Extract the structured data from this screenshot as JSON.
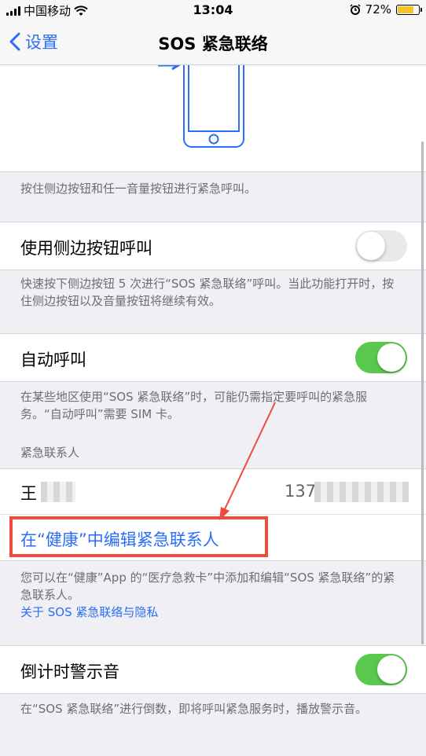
{
  "status": {
    "carrier": "中国移动",
    "time": "13:04",
    "battery": "72%",
    "battery_level": 0.72
  },
  "nav": {
    "back_label": "设置",
    "title": "SOS 紧急联络"
  },
  "illustration": {
    "icon": "phone-side-button-icon"
  },
  "hold_note": "按住侧边按钮和任一音量按钮进行紧急呼叫。",
  "side_button": {
    "label": "使用侧边按钮呼叫",
    "on": false
  },
  "side_note": "快速按下侧边按钮 5 次进行“SOS 紧急联络”呼叫。当此功能打开时，按住侧边按钮以及音量按钮将继续有效。",
  "auto_call": {
    "label": "自动呼叫",
    "on": true
  },
  "auto_note": "在某些地区使用“SOS 紧急联络”时，可能仍需指定要呼叫的紧急服务。“自动呼叫”需要 SIM 卡。",
  "contacts_header": "紧急联系人",
  "contact": {
    "name": "王",
    "phone": "137"
  },
  "edit_link": "在“健康”中编辑紧急联系人",
  "contacts_note": "您可以在“健康”App 的“医疗急救卡”中添加和编辑“SOS 紧急联络”的紧急联系人。",
  "privacy_link": "关于 SOS 紧急联络与隐私",
  "countdown": {
    "label": "倒计时警示音",
    "on": true
  },
  "countdown_note": "在“SOS 紧急联络”进行倒数，即将呼叫紧急服务时，播放警示音。",
  "colors": {
    "accent": "#2a6ef6",
    "toggle_on": "#5ac84d",
    "annotation": "#ee4b3b"
  }
}
